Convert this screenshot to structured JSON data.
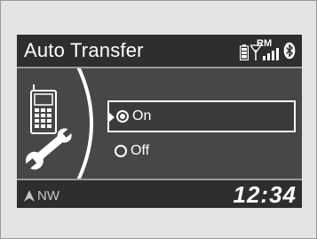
{
  "header": {
    "title": "Auto Transfer",
    "status": {
      "roaming_label": "RM"
    },
    "icons": [
      "phone-battery-icon",
      "signal-strength-icon",
      "bluetooth-icon"
    ]
  },
  "panel": {
    "icon": "phone-settings-icon"
  },
  "options": [
    {
      "label": "On",
      "selected": true
    },
    {
      "label": "Off",
      "selected": false
    }
  ],
  "footer": {
    "compass": "NW",
    "time": "12:34"
  },
  "colors": {
    "screen_bg": "#474747",
    "bar_bg": "#2e2e2e",
    "text": "#ffffff",
    "frame_bg": "#e4e4e4"
  }
}
